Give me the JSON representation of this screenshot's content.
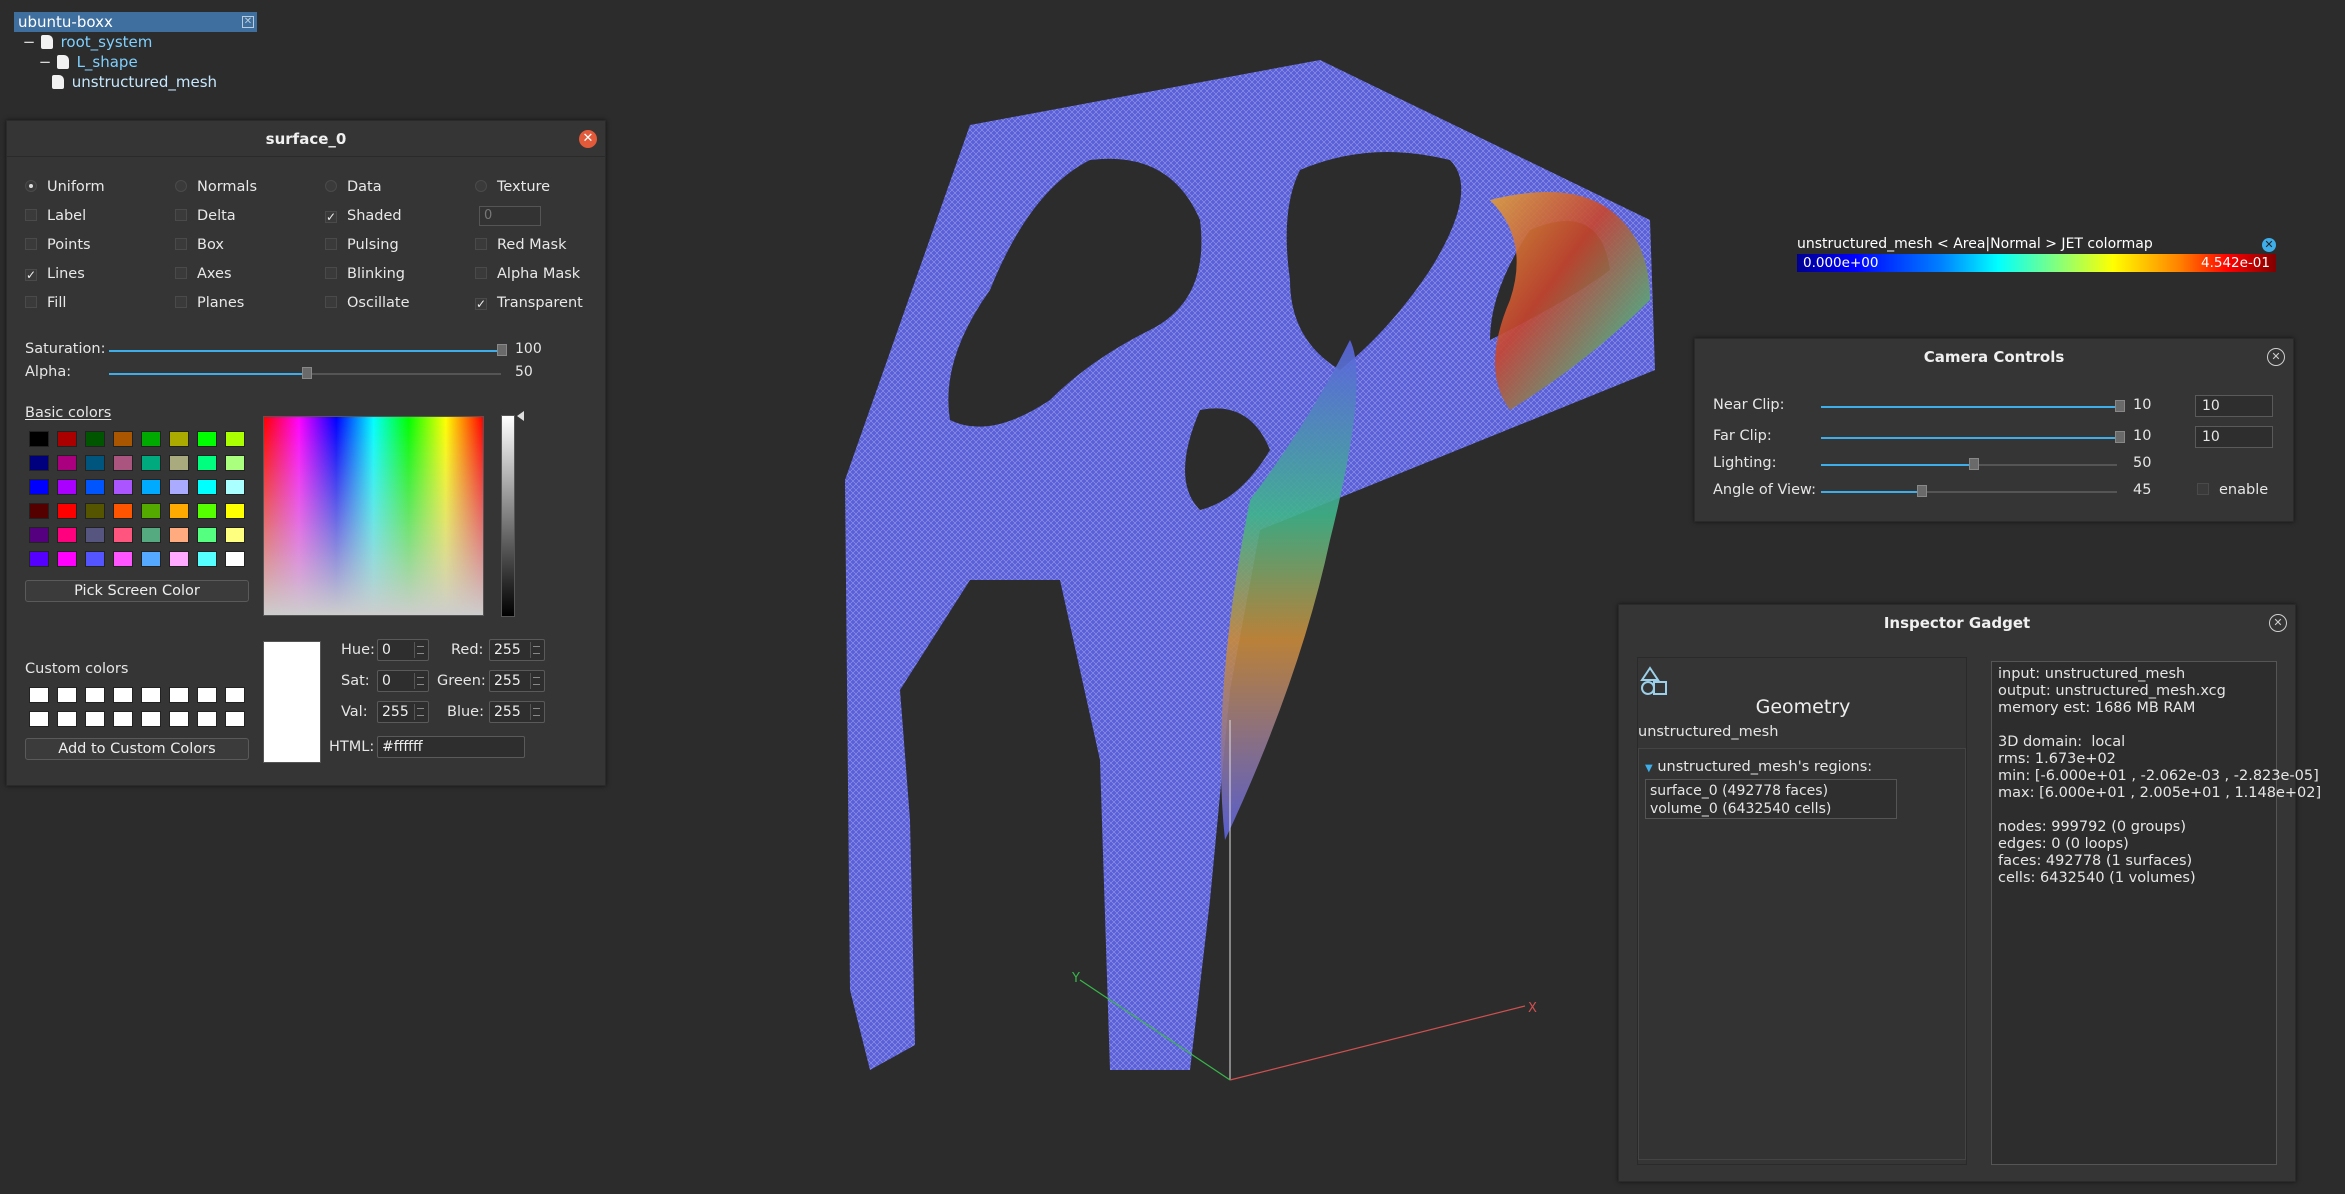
{
  "tree": {
    "root": "ubuntu-boxx",
    "items": [
      {
        "toggle": "−",
        "label": "root_system"
      },
      {
        "toggle": "−",
        "label": "L_shape"
      },
      {
        "toggle": "",
        "label": "unstructured_mesh"
      }
    ]
  },
  "surface": {
    "title": "surface_0",
    "options": [
      {
        "label": "Uniform",
        "kind": "radio",
        "on": true
      },
      {
        "label": "Normals",
        "kind": "radio",
        "on": false
      },
      {
        "label": "Data",
        "kind": "radio",
        "on": false
      },
      {
        "label": "Texture",
        "kind": "radio",
        "on": false
      },
      {
        "label": "Label",
        "kind": "check",
        "on": false
      },
      {
        "label": "Delta",
        "kind": "check",
        "on": false
      },
      {
        "label": "Shaded",
        "kind": "check",
        "on": true
      },
      {
        "label": "",
        "kind": "none",
        "on": false
      },
      {
        "label": "Points",
        "kind": "check",
        "on": false
      },
      {
        "label": "Box",
        "kind": "check",
        "on": false
      },
      {
        "label": "Pulsing",
        "kind": "check",
        "on": false
      },
      {
        "label": "Red Mask",
        "kind": "check",
        "on": false
      },
      {
        "label": "Lines",
        "kind": "check",
        "on": true
      },
      {
        "label": "Axes",
        "kind": "check",
        "on": false
      },
      {
        "label": "Blinking",
        "kind": "check",
        "on": false
      },
      {
        "label": "Alpha Mask",
        "kind": "check",
        "on": false
      },
      {
        "label": "Fill",
        "kind": "check",
        "on": false
      },
      {
        "label": "Planes",
        "kind": "check",
        "on": false
      },
      {
        "label": "Oscillate",
        "kind": "check",
        "on": false
      },
      {
        "label": "Transparent",
        "kind": "check",
        "on": true
      }
    ],
    "texture_value": "0",
    "saturation_label": "Saturation:",
    "saturation_value": "100",
    "alpha_label": "Alpha:",
    "alpha_value": "50",
    "basic_colors_label": "Basic colors",
    "basic_colors": [
      "#000000",
      "#aa0000",
      "#005500",
      "#aa5500",
      "#00aa00",
      "#aaaa00",
      "#00ff00",
      "#aaff00",
      "#00007f",
      "#aa007f",
      "#00557f",
      "#aa557f",
      "#00aa7f",
      "#aaaa7f",
      "#00ff7f",
      "#aaff7f",
      "#0000ff",
      "#aa00ff",
      "#0055ff",
      "#aa55ff",
      "#00aaff",
      "#aaaaff",
      "#00ffff",
      "#aaffff",
      "#550000",
      "#ff0000",
      "#555500",
      "#ff5500",
      "#55aa00",
      "#ffaa00",
      "#55ff00",
      "#ffff00",
      "#55007f",
      "#ff007f",
      "#55557f",
      "#ff557f",
      "#55aa7f",
      "#ffaa7f",
      "#55ff7f",
      "#ffff7f",
      "#5500ff",
      "#ff00ff",
      "#5555ff",
      "#ff55ff",
      "#55aaff",
      "#ffaaff",
      "#55ffff",
      "#ffffff"
    ],
    "pick_screen_color": "Pick Screen Color",
    "custom_colors_label": "Custom colors",
    "add_custom": "Add to Custom Colors",
    "hue_label": "Hue:",
    "hue": "0",
    "sat_label": "Sat:",
    "sat": "0",
    "val_label": "Val:",
    "val": "255",
    "red_label": "Red:",
    "red": "255",
    "green_label": "Green:",
    "green": "255",
    "blue_label": "Blue:",
    "blue": "255",
    "html_label": "HTML:",
    "html": "#ffffff"
  },
  "colorbar": {
    "title": "unstructured_mesh < Area|Normal > JET colormap",
    "min": "0.000e+00",
    "max": "4.542e-01"
  },
  "axes": {
    "x": "X",
    "y": "Y"
  },
  "camera": {
    "title": "Camera Controls",
    "near_label": "Near Clip:",
    "near_value": "10",
    "near_box": "10",
    "far_label": "Far Clip:",
    "far_value": "10",
    "far_box": "10",
    "lighting_label": "Lighting:",
    "lighting_value": "50",
    "aov_label": "Angle of View:",
    "aov_value": "45",
    "enable_label": "enable"
  },
  "inspector": {
    "title": "Inspector Gadget",
    "geometry_title": "Geometry",
    "mesh_name": "unstructured_mesh",
    "regions_header": "unstructured_mesh's regions:",
    "regions": [
      "surface_0 (492778 faces)",
      "volume_0 (6432540 cells)"
    ],
    "info": "input: unstructured_mesh\noutput: unstructured_mesh.xcg\nmemory est: 1686 MB RAM\n\n3D domain:  local\nrms: 1.673e+02\nmin: [-6.000e+01 , -2.062e-03 , -2.823e-05]\nmax: [6.000e+01 , 2.005e+01 , 1.148e+02]\n\nnodes: 999792 (0 groups)\nedges: 0 (0 loops)\nfaces: 492778 (1 surfaces)\ncells: 6432540 (1 volumes)"
  }
}
